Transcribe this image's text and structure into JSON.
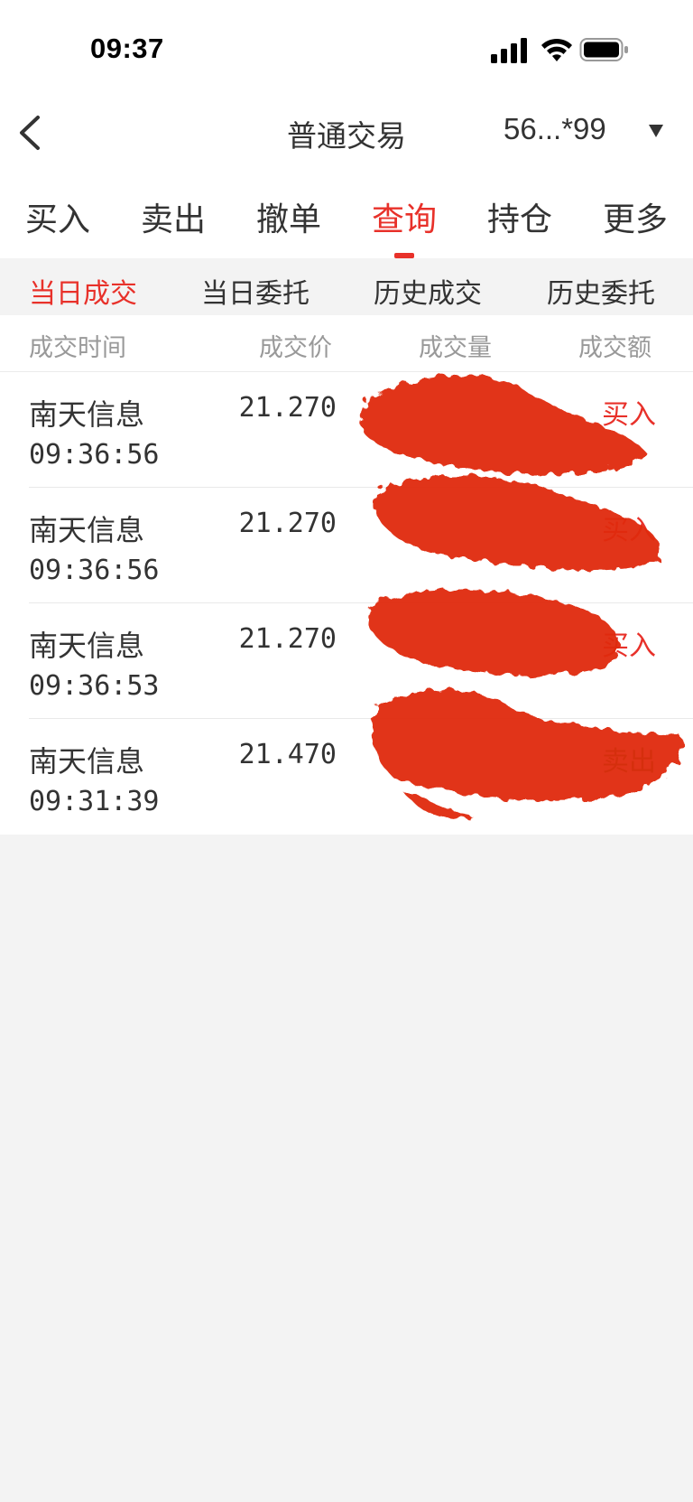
{
  "status_bar": {
    "time": "09:37",
    "icons": [
      "cellular-signal-icon",
      "wifi-icon",
      "battery-icon"
    ]
  },
  "nav": {
    "title": "普通交易",
    "account": "56...*99",
    "back_icon": "chevron-left-icon",
    "account_caret_icon": "caret-down-icon"
  },
  "tabs": [
    {
      "label": "买入"
    },
    {
      "label": "卖出"
    },
    {
      "label": "撤单"
    },
    {
      "label": "查询",
      "active": true
    },
    {
      "label": "持仓"
    },
    {
      "label": "更多"
    }
  ],
  "subtabs": [
    {
      "label": "当日成交",
      "active": true
    },
    {
      "label": "当日委托"
    },
    {
      "label": "历史成交"
    },
    {
      "label": "历史委托"
    }
  ],
  "columns": {
    "time": "成交时间",
    "price": "成交价",
    "volume": "成交量",
    "amount": "成交额"
  },
  "trades": [
    {
      "stock": "南天信息",
      "time": "09:36:56",
      "price": "21.270",
      "side": "买入",
      "side_type": "buy"
    },
    {
      "stock": "南天信息",
      "time": "09:36:56",
      "price": "21.270",
      "side": "买入",
      "side_type": "buy"
    },
    {
      "stock": "南天信息",
      "time": "09:36:53",
      "price": "21.270",
      "side": "买入",
      "side_type": "buy"
    },
    {
      "stock": "南天信息",
      "time": "09:31:39",
      "price": "21.470",
      "side": "卖出",
      "side_type": "sell"
    }
  ],
  "colors": {
    "accent": "#e8312a",
    "sell": "#1aa01a",
    "redaction": "#e02a10"
  }
}
